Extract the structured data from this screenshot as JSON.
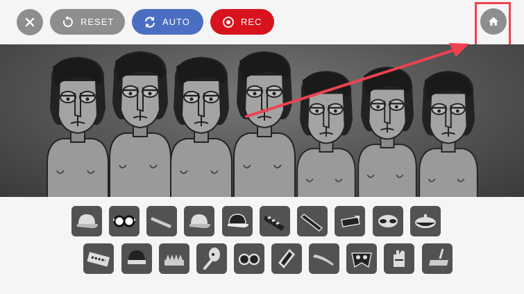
{
  "toolbar": {
    "close_icon": "close-icon",
    "reset_label": "RESET",
    "reset_icon": "refresh-icon",
    "auto_label": "AUTO",
    "auto_icon": "sync-icon",
    "rec_label": "REC",
    "rec_icon": "record-icon",
    "home_icon": "home-icon"
  },
  "colors": {
    "grey_button": "#8e8e8e",
    "auto_blue": "#4a6fc2",
    "rec_red": "#d8131e",
    "highlight_red": "#f0424e",
    "icon_slot": "#525252"
  },
  "stage": {
    "character_count": 7
  },
  "icon_tray": {
    "row1": [
      "cap-icon",
      "goggles-icon",
      "headband-icon",
      "cap-icon",
      "cap-dark-icon",
      "striped-band-icon",
      "band-icon",
      "hat-icon",
      "mask-icon",
      "beret-icon"
    ],
    "row2": [
      "keyboard-icon",
      "beanie-icon",
      "spiked-band-icon",
      "microphone-icon",
      "glasses-icon",
      "diamond-icon",
      "headband-thin-icon",
      "bat-mask-icon",
      "glove-icon",
      "broom-icon"
    ]
  }
}
